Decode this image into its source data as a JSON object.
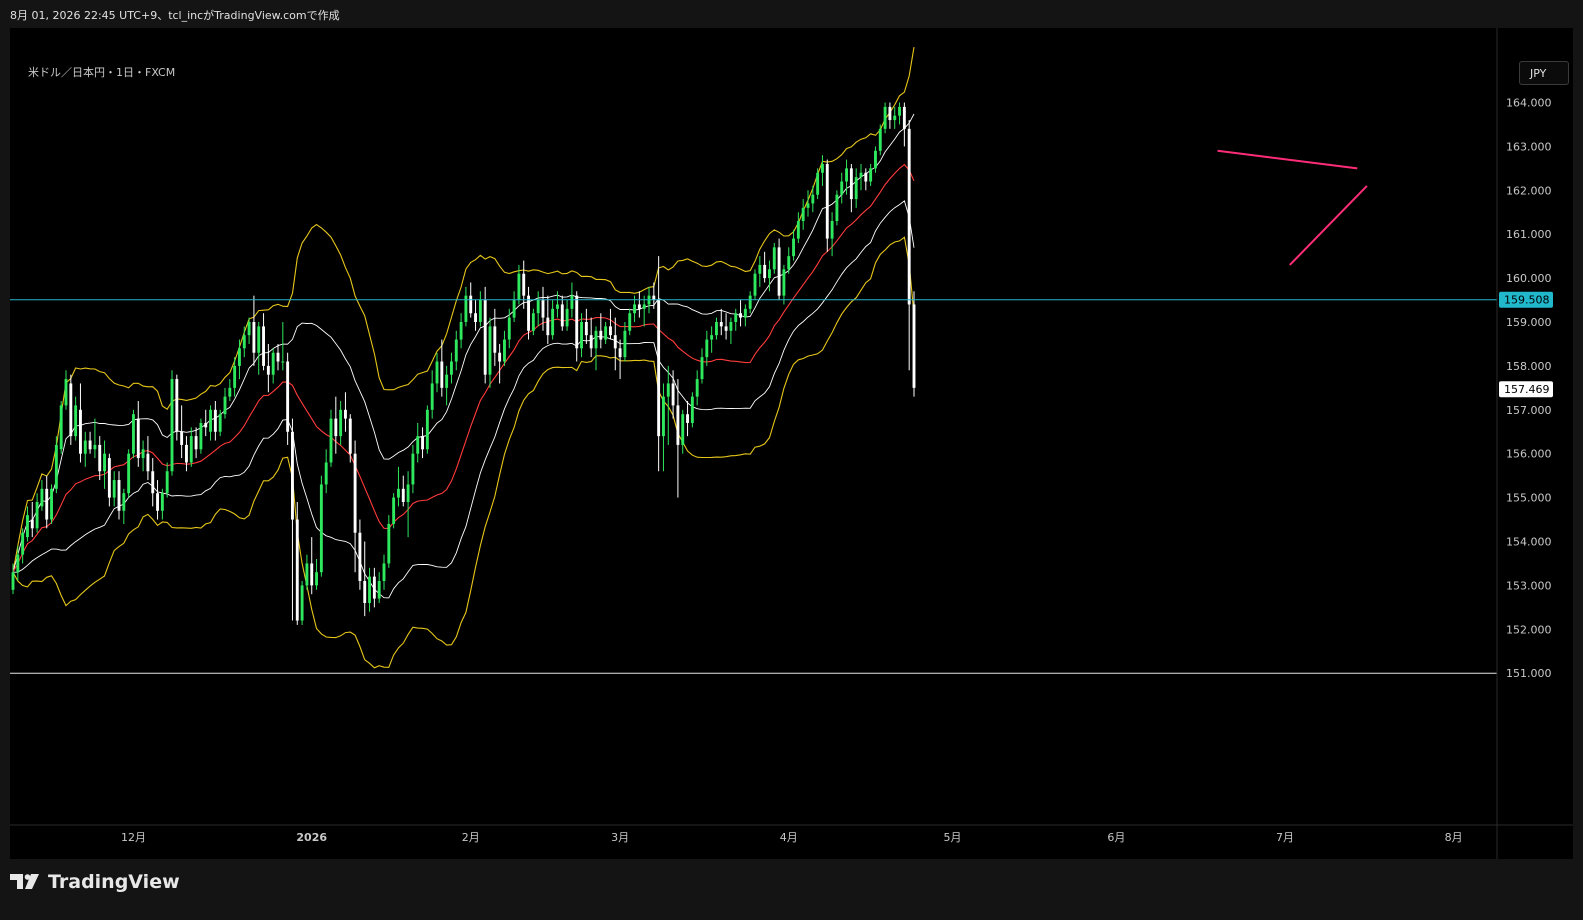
{
  "header": {
    "caption": "8月 01, 2026 22:45 UTC+9、tcl_incがTradingView.comで作成"
  },
  "symbol": {
    "title": "米ドル／日本円・1日・FXCM"
  },
  "currency_button": {
    "label": "JPY"
  },
  "brand": {
    "name": "TradingView"
  },
  "colors": {
    "background": "#000000",
    "candle_up": "#2ee85e",
    "candle_down": "#ffffff",
    "ma_short": "#ffffff",
    "ma_long": "#ff3b3b",
    "bollinger": "#e6c619",
    "trendline": "#ff2d78",
    "price_line": "#22b8cc"
  },
  "chart_data": {
    "type": "candlestick",
    "title": "米ドル／日本円・1日・FXCM",
    "y_ticks": [
      "151.000",
      "152.000",
      "153.000",
      "154.000",
      "155.000",
      "156.000",
      "157.000",
      "158.000",
      "159.000",
      "160.000",
      "161.000",
      "162.000",
      "163.000",
      "164.000"
    ],
    "ylim": [
      151,
      164.6
    ],
    "x_ticks": [
      {
        "label": "12月",
        "index": 25
      },
      {
        "label": "2026",
        "index": 62
      },
      {
        "label": "2月",
        "index": 95
      },
      {
        "label": "3月",
        "index": 126
      },
      {
        "label": "4月",
        "index": 161
      },
      {
        "label": "5月",
        "index": 195
      },
      {
        "label": "6月",
        "index": 229
      },
      {
        "label": "7月",
        "index": 264
      },
      {
        "label": "8月",
        "index": 299
      }
    ],
    "x_range": [
      0,
      308
    ],
    "last_index": 299,
    "current_price": {
      "value": 157.469,
      "label": "157.469"
    },
    "horizontal_line": {
      "value": 159.508,
      "label": "159.508"
    },
    "support_line": {
      "value": 151.0
    },
    "trendlines": [
      {
        "from": [
          250,
          162.9
        ],
        "to": [
          279,
          162.5
        ]
      },
      {
        "from": [
          265,
          160.3
        ],
        "to": [
          281,
          162.1
        ]
      }
    ],
    "ohlc": [
      [
        152.9,
        153.5,
        152.8,
        153.3
      ],
      [
        153.3,
        153.9,
        153.1,
        153.7
      ],
      [
        153.7,
        154.3,
        153.5,
        154.2
      ],
      [
        154.1,
        154.8,
        154.0,
        154.6
      ],
      [
        154.5,
        154.9,
        154.1,
        154.3
      ],
      [
        154.3,
        155.1,
        154.2,
        154.9
      ],
      [
        154.8,
        155.4,
        154.7,
        155.2
      ],
      [
        155.2,
        155.5,
        154.3,
        154.5
      ],
      [
        154.5,
        155.3,
        154.4,
        155.2
      ],
      [
        155.2,
        156.4,
        155.1,
        156.2
      ],
      [
        156.1,
        157.2,
        156.0,
        157.1
      ],
      [
        157.1,
        157.9,
        157.0,
        157.7
      ],
      [
        157.6,
        157.8,
        156.2,
        156.4
      ],
      [
        156.4,
        157.3,
        156.3,
        157.1
      ],
      [
        157.0,
        157.6,
        155.8,
        156.0
      ],
      [
        156.0,
        156.5,
        155.7,
        156.3
      ],
      [
        156.3,
        156.5,
        156.0,
        156.1
      ],
      [
        156.1,
        156.8,
        155.9,
        156.2
      ],
      [
        156.2,
        156.4,
        155.4,
        155.6
      ],
      [
        155.6,
        156.3,
        155.2,
        156.0
      ],
      [
        155.9,
        156.0,
        154.8,
        155.0
      ],
      [
        155.0,
        155.6,
        154.8,
        155.4
      ],
      [
        155.4,
        155.6,
        154.5,
        154.7
      ],
      [
        154.7,
        155.2,
        154.4,
        155.1
      ],
      [
        155.1,
        156.1,
        155.0,
        156.0
      ],
      [
        156.0,
        157.0,
        155.9,
        156.9
      ],
      [
        156.8,
        157.2,
        155.7,
        155.9
      ],
      [
        155.9,
        156.3,
        155.6,
        156.1
      ],
      [
        156.0,
        156.4,
        155.4,
        155.6
      ],
      [
        155.6,
        155.9,
        154.8,
        155.1
      ],
      [
        155.1,
        155.4,
        154.5,
        154.7
      ],
      [
        154.7,
        155.2,
        154.5,
        155.1
      ],
      [
        155.1,
        155.8,
        155.0,
        155.6
      ],
      [
        155.6,
        157.9,
        155.5,
        157.7
      ],
      [
        157.7,
        157.8,
        156.3,
        156.5
      ],
      [
        156.5,
        157.1,
        155.9,
        156.2
      ],
      [
        156.2,
        156.4,
        155.6,
        155.8
      ],
      [
        155.8,
        156.6,
        155.7,
        156.4
      ],
      [
        156.4,
        156.6,
        155.9,
        156.1
      ],
      [
        156.1,
        156.8,
        156.0,
        156.7
      ],
      [
        156.7,
        157.0,
        156.4,
        156.6
      ],
      [
        156.5,
        157.1,
        156.3,
        157.0
      ],
      [
        157.0,
        157.2,
        156.3,
        156.5
      ],
      [
        156.5,
        157.0,
        156.4,
        156.9
      ],
      [
        156.9,
        157.5,
        156.8,
        157.3
      ],
      [
        157.3,
        157.7,
        157.2,
        157.5
      ],
      [
        157.5,
        158.2,
        157.3,
        158.0
      ],
      [
        158.0,
        158.6,
        157.7,
        158.4
      ],
      [
        158.4,
        158.9,
        158.2,
        158.7
      ],
      [
        158.7,
        159.1,
        158.5,
        159.0
      ],
      [
        159.0,
        159.6,
        158.0,
        158.3
      ],
      [
        158.3,
        159.0,
        157.8,
        158.9
      ],
      [
        158.9,
        159.2,
        157.9,
        158.0
      ],
      [
        158.0,
        158.5,
        157.4,
        157.8
      ],
      [
        157.8,
        158.4,
        157.6,
        158.3
      ],
      [
        158.3,
        158.5,
        157.9,
        158.1
      ],
      [
        158.1,
        159.0,
        157.9,
        158.1
      ],
      [
        158.1,
        158.3,
        156.2,
        156.5
      ],
      [
        156.5,
        156.8,
        152.2,
        154.5
      ],
      [
        154.5,
        154.9,
        152.1,
        152.2
      ],
      [
        152.2,
        153.1,
        152.1,
        153.0
      ],
      [
        153.0,
        153.7,
        152.9,
        153.5
      ],
      [
        153.5,
        154.1,
        152.8,
        153.0
      ],
      [
        153.0,
        153.6,
        152.9,
        153.3
      ],
      [
        153.3,
        155.5,
        153.2,
        155.3
      ],
      [
        155.3,
        156.1,
        155.1,
        155.8
      ],
      [
        155.8,
        157.0,
        155.7,
        156.8
      ],
      [
        156.8,
        157.3,
        156.0,
        156.4
      ],
      [
        156.4,
        157.2,
        156.2,
        157.0
      ],
      [
        157.0,
        157.4,
        156.5,
        156.8
      ],
      [
        156.8,
        156.9,
        155.8,
        156.0
      ],
      [
        156.0,
        156.3,
        153.3,
        154.2
      ],
      [
        154.2,
        154.5,
        152.9,
        153.1
      ],
      [
        153.1,
        154.0,
        152.3,
        152.6
      ],
      [
        152.6,
        153.4,
        152.4,
        153.2
      ],
      [
        153.2,
        153.4,
        152.5,
        152.7
      ],
      [
        152.7,
        153.3,
        152.6,
        153.1
      ],
      [
        153.1,
        153.7,
        152.9,
        153.5
      ],
      [
        153.5,
        154.6,
        153.4,
        154.4
      ],
      [
        154.4,
        155.1,
        154.3,
        155.0
      ],
      [
        155.0,
        155.7,
        154.8,
        155.2
      ],
      [
        155.2,
        155.5,
        154.8,
        154.9
      ],
      [
        154.9,
        155.6,
        154.1,
        155.3
      ],
      [
        155.3,
        156.2,
        155.1,
        156.0
      ],
      [
        156.0,
        156.7,
        155.8,
        156.4
      ],
      [
        156.4,
        156.6,
        155.9,
        156.1
      ],
      [
        156.1,
        157.1,
        156.0,
        157.0
      ],
      [
        157.0,
        157.9,
        156.8,
        157.6
      ],
      [
        157.6,
        158.3,
        157.4,
        158.1
      ],
      [
        158.1,
        158.6,
        157.3,
        157.5
      ],
      [
        157.5,
        158.0,
        157.1,
        157.8
      ],
      [
        157.8,
        158.3,
        157.6,
        158.1
      ],
      [
        158.1,
        158.8,
        157.9,
        158.6
      ],
      [
        158.6,
        159.2,
        158.4,
        159.0
      ],
      [
        159.0,
        159.8,
        158.9,
        159.6
      ],
      [
        159.6,
        159.9,
        159.1,
        159.2
      ],
      [
        159.2,
        159.5,
        158.8,
        159.0
      ],
      [
        159.0,
        159.7,
        158.9,
        159.5
      ],
      [
        159.5,
        159.8,
        157.6,
        157.8
      ],
      [
        157.8,
        159.1,
        157.5,
        158.9
      ],
      [
        158.9,
        159.3,
        158.0,
        158.3
      ],
      [
        158.3,
        158.5,
        157.6,
        158.1
      ],
      [
        158.1,
        158.8,
        158.0,
        158.6
      ],
      [
        158.6,
        159.3,
        158.4,
        159.1
      ],
      [
        159.1,
        159.7,
        159.0,
        159.5
      ],
      [
        159.5,
        160.3,
        159.4,
        160.1
      ],
      [
        160.1,
        160.4,
        159.3,
        159.6
      ],
      [
        159.6,
        159.8,
        158.6,
        158.8
      ],
      [
        158.8,
        159.3,
        158.7,
        159.2
      ],
      [
        159.2,
        159.7,
        158.9,
        159.5
      ],
      [
        159.5,
        159.8,
        158.8,
        159.1
      ],
      [
        159.1,
        159.6,
        158.5,
        158.7
      ],
      [
        158.7,
        159.5,
        158.6,
        159.3
      ],
      [
        159.3,
        159.7,
        159.1,
        159.4
      ],
      [
        159.4,
        159.6,
        158.8,
        158.9
      ],
      [
        158.9,
        159.5,
        158.8,
        159.3
      ],
      [
        159.3,
        159.9,
        159.1,
        159.6
      ],
      [
        159.6,
        159.7,
        158.1,
        158.4
      ],
      [
        158.4,
        159.2,
        158.2,
        159.0
      ],
      [
        159.0,
        159.3,
        158.5,
        158.7
      ],
      [
        158.7,
        159.1,
        158.2,
        158.4
      ],
      [
        158.4,
        158.9,
        157.9,
        158.8
      ],
      [
        158.8,
        159.2,
        158.4,
        158.6
      ],
      [
        158.6,
        159.0,
        158.5,
        158.9
      ],
      [
        158.9,
        159.3,
        158.6,
        158.7
      ],
      [
        158.7,
        159.1,
        157.9,
        158.4
      ],
      [
        158.4,
        158.6,
        157.7,
        158.2
      ],
      [
        158.2,
        159.0,
        158.1,
        158.8
      ],
      [
        158.8,
        159.3,
        158.7,
        159.2
      ],
      [
        159.2,
        159.6,
        159.0,
        159.4
      ],
      [
        159.4,
        159.7,
        159.1,
        159.3
      ],
      [
        159.3,
        159.6,
        158.9,
        159.4
      ],
      [
        159.4,
        159.8,
        159.2,
        159.6
      ],
      [
        159.6,
        159.9,
        159.3,
        159.5
      ],
      [
        159.5,
        160.5,
        155.6,
        156.4
      ],
      [
        156.4,
        157.6,
        155.6,
        157.3
      ],
      [
        157.3,
        158.0,
        156.2,
        157.6
      ],
      [
        157.6,
        157.9,
        156.8,
        157.1
      ],
      [
        157.1,
        157.7,
        155.0,
        156.2
      ],
      [
        156.2,
        157.0,
        156.0,
        156.9
      ],
      [
        156.9,
        157.2,
        156.4,
        156.7
      ],
      [
        156.7,
        157.4,
        156.6,
        157.3
      ],
      [
        157.3,
        157.9,
        157.1,
        157.7
      ],
      [
        157.7,
        158.4,
        157.6,
        158.2
      ],
      [
        158.2,
        158.8,
        158.0,
        158.6
      ],
      [
        158.6,
        158.9,
        158.3,
        158.7
      ],
      [
        158.7,
        159.1,
        158.6,
        159.0
      ],
      [
        159.0,
        159.3,
        158.7,
        158.9
      ],
      [
        158.9,
        159.2,
        158.6,
        158.8
      ],
      [
        158.8,
        159.1,
        158.5,
        159.0
      ],
      [
        159.0,
        159.3,
        158.8,
        159.2
      ],
      [
        159.2,
        159.5,
        158.9,
        159.1
      ],
      [
        159.1,
        159.4,
        158.9,
        159.3
      ],
      [
        159.3,
        159.7,
        159.2,
        159.6
      ],
      [
        159.6,
        160.2,
        159.5,
        160.1
      ],
      [
        160.1,
        160.5,
        159.8,
        160.3
      ],
      [
        160.3,
        160.6,
        159.9,
        160.0
      ],
      [
        160.0,
        160.4,
        159.7,
        160.2
      ],
      [
        160.2,
        160.8,
        160.1,
        160.7
      ],
      [
        160.7,
        160.9,
        159.5,
        159.6
      ],
      [
        159.6,
        160.3,
        159.4,
        160.2
      ],
      [
        160.2,
        160.7,
        160.1,
        160.5
      ],
      [
        160.5,
        161.1,
        160.4,
        160.9
      ],
      [
        160.9,
        161.5,
        160.8,
        161.3
      ],
      [
        161.3,
        161.8,
        161.1,
        161.6
      ],
      [
        161.6,
        162.0,
        161.4,
        161.7
      ],
      [
        161.7,
        162.1,
        161.5,
        161.9
      ],
      [
        161.9,
        162.5,
        161.8,
        162.4
      ],
      [
        162.4,
        162.8,
        162.1,
        162.6
      ],
      [
        162.6,
        162.7,
        160.6,
        160.9
      ],
      [
        160.9,
        161.5,
        160.5,
        161.3
      ],
      [
        161.3,
        162.0,
        161.2,
        161.9
      ],
      [
        161.9,
        162.4,
        161.7,
        162.2
      ],
      [
        162.2,
        162.7,
        161.9,
        162.5
      ],
      [
        162.5,
        162.6,
        161.5,
        161.8
      ],
      [
        161.8,
        162.5,
        161.6,
        162.3
      ],
      [
        162.3,
        162.6,
        162.0,
        162.4
      ],
      [
        162.4,
        162.5,
        162.0,
        162.2
      ],
      [
        162.2,
        162.6,
        162.1,
        162.5
      ],
      [
        162.5,
        163.0,
        162.4,
        162.9
      ],
      [
        162.9,
        163.5,
        162.8,
        163.4
      ],
      [
        163.4,
        164.0,
        163.3,
        163.9
      ],
      [
        163.9,
        164.0,
        163.4,
        163.6
      ],
      [
        163.6,
        163.9,
        163.4,
        163.7
      ],
      [
        163.7,
        164.0,
        163.5,
        163.9
      ],
      [
        163.9,
        164.0,
        163.0,
        163.4
      ],
      [
        163.4,
        163.6,
        157.9,
        159.4
      ],
      [
        159.4,
        159.7,
        157.3,
        157.5
      ]
    ]
  }
}
